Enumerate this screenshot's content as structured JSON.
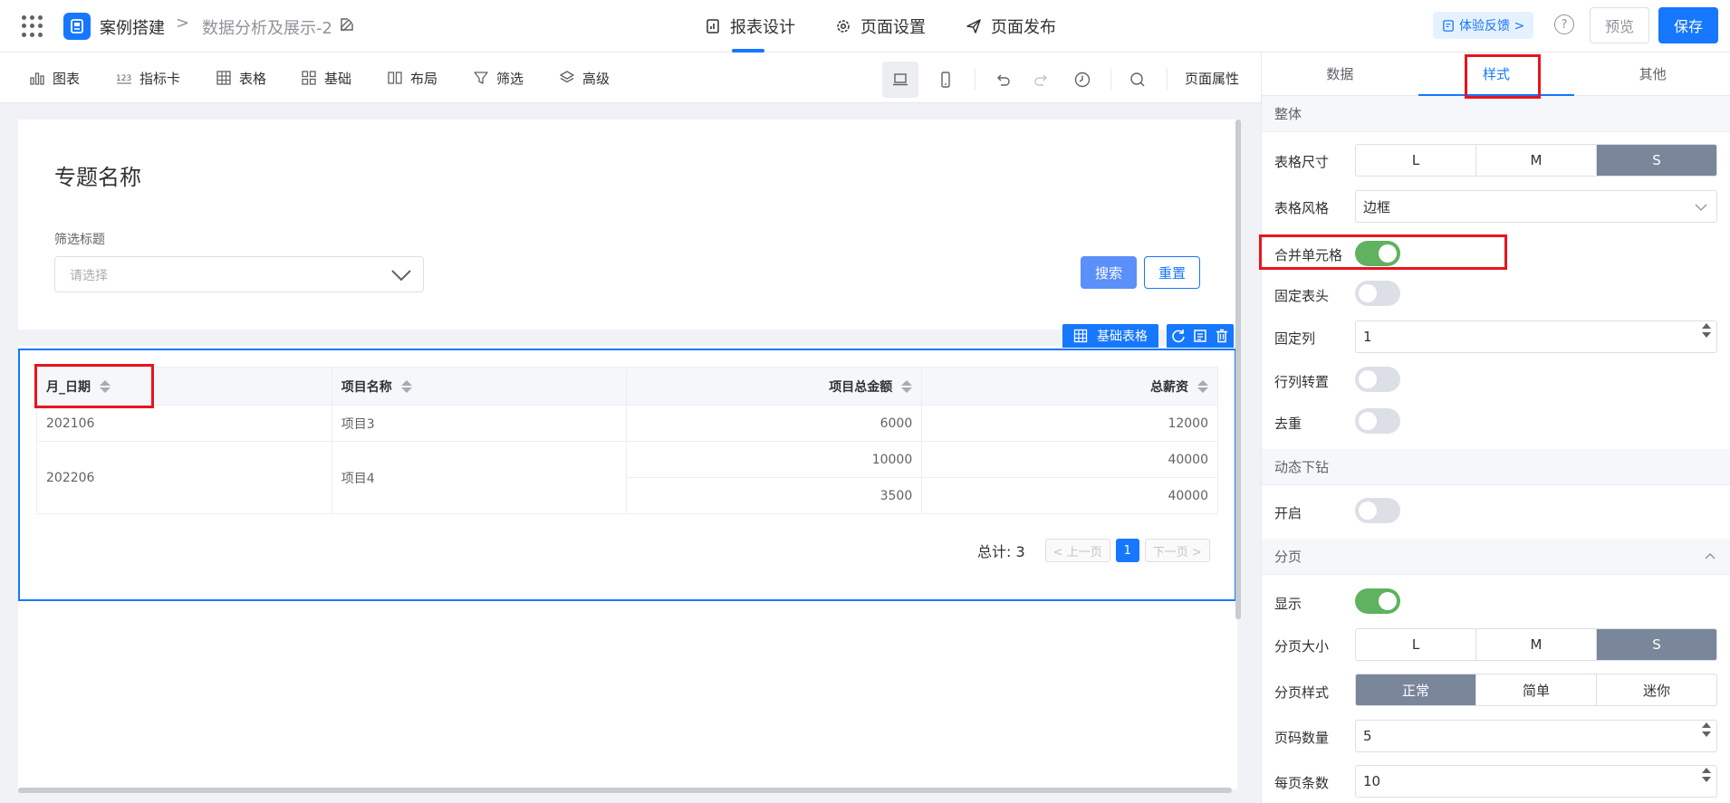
{
  "header": {
    "app_name": "案例搭建",
    "breadcrumb_sep": ">",
    "page_name": "数据分析及展示-2",
    "tabs": [
      {
        "label": "报表设计",
        "icon": "report-design-icon"
      },
      {
        "label": "页面设置",
        "icon": "gear-icon"
      },
      {
        "label": "页面发布",
        "icon": "send-icon"
      }
    ],
    "feedback_label": "体验反馈 >",
    "help_label": "?",
    "preview_label": "预览",
    "save_label": "保存"
  },
  "toolbar": {
    "items": [
      {
        "label": "图表",
        "icon": "bar-chart-icon"
      },
      {
        "label": "指标卡",
        "icon": "metric-card-icon"
      },
      {
        "label": "表格",
        "icon": "table-icon"
      },
      {
        "label": "基础",
        "icon": "basic-grid-icon"
      },
      {
        "label": "布局",
        "icon": "layout-icon"
      },
      {
        "label": "筛选",
        "icon": "filter-icon"
      },
      {
        "label": "高级",
        "icon": "layers-icon"
      }
    ],
    "page_props_label": "页面属性"
  },
  "canvas": {
    "topic_title": "专题名称",
    "filter_label": "筛选标题",
    "filter_placeholder": "请选择",
    "search_label": "搜索",
    "reset_label": "重置",
    "widget_tag_label": "基础表格",
    "table": {
      "headers": [
        "月_日期",
        "项目名称",
        "项目总金额",
        "总薪资"
      ],
      "rows": [
        {
          "date": "202106",
          "project": "项目3",
          "amounts": [
            "6000"
          ],
          "salaries": [
            "12000"
          ]
        },
        {
          "date": "202206",
          "project": "项目4",
          "amounts": [
            "10000",
            "3500"
          ],
          "salaries": [
            "40000",
            "40000"
          ]
        }
      ]
    },
    "pager": {
      "total_label": "总计: 3",
      "prev_label": "< 上一页",
      "current_page": "1",
      "next_label": "下一页 >"
    }
  },
  "panel": {
    "tabs": [
      "数据",
      "样式",
      "其他"
    ],
    "active_tab": "样式",
    "sections": {
      "overall": "整体",
      "drill": "动态下钻",
      "paging": "分页"
    },
    "table_size_label": "表格尺寸",
    "table_size_options": [
      "L",
      "M",
      "S"
    ],
    "table_size_selected": "S",
    "table_style_label": "表格风格",
    "table_style_value": "边框",
    "merge_cells_label": "合并单元格",
    "merge_cells_on": true,
    "fixed_header_label": "固定表头",
    "fixed_header_on": false,
    "fixed_col_label": "固定列",
    "fixed_col_value": "1",
    "transpose_label": "行列转置",
    "transpose_on": false,
    "dedupe_label": "去重",
    "dedupe_on": false,
    "drill_enable_label": "开启",
    "drill_enable_on": false,
    "paging_show_label": "显示",
    "paging_show_on": true,
    "page_size_label": "分页大小",
    "page_size_options": [
      "L",
      "M",
      "S"
    ],
    "page_size_selected": "S",
    "page_style_label": "分页样式",
    "page_style_options": [
      "正常",
      "简单",
      "迷你"
    ],
    "page_style_selected": "正常",
    "page_count_label": "页码数量",
    "page_count_value": "5",
    "per_page_label": "每页条数",
    "per_page_value": "10"
  },
  "colors": {
    "primary": "#1677ff",
    "switch_on": "#5fb25f",
    "segment_on": "#7a8699",
    "highlight": "#e8141e"
  }
}
